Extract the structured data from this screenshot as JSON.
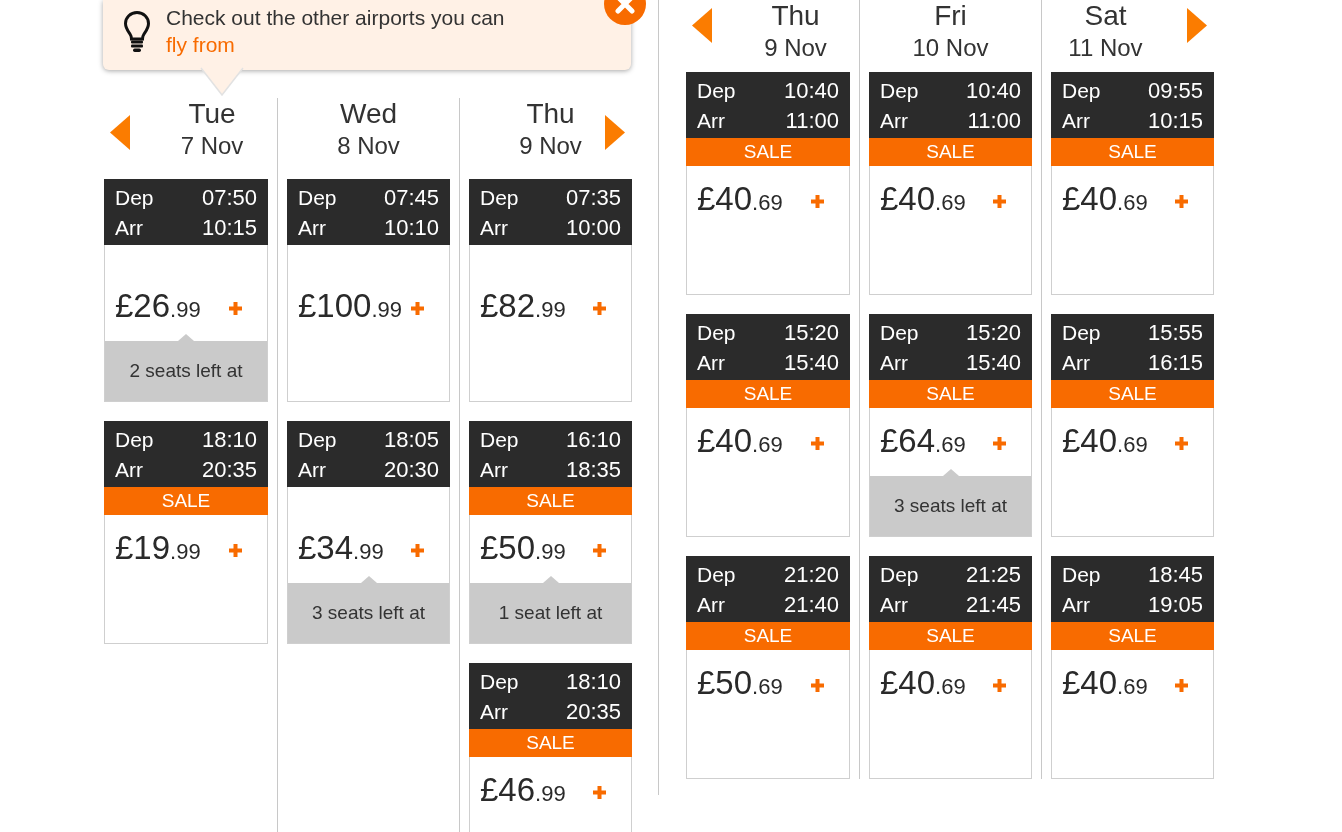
{
  "tip": {
    "text": "Check out the other airports you can",
    "link": "fly from"
  },
  "panels": [
    {
      "days": [
        {
          "name": "Tue",
          "date": "7 Nov",
          "flights": [
            {
              "dep_label": "Dep",
              "dep_time": "07:50",
              "arr_label": "Arr",
              "arr_time": "10:15",
              "price": "£26",
              "pence": ".99",
              "seats": "2 seats left at"
            },
            {
              "dep_label": "Dep",
              "dep_time": "18:10",
              "arr_label": "Arr",
              "arr_time": "20:35",
              "badge": "SALE",
              "price": "£19",
              "pence": ".99"
            }
          ]
        },
        {
          "name": "Wed",
          "date": "8 Nov",
          "flights": [
            {
              "dep_label": "Dep",
              "dep_time": "07:45",
              "arr_label": "Arr",
              "arr_time": "10:10",
              "price": "£100",
              "pence": ".99"
            },
            {
              "dep_label": "Dep",
              "dep_time": "18:05",
              "arr_label": "Arr",
              "arr_time": "20:30",
              "price": "£34",
              "pence": ".99",
              "seats": "3 seats left at"
            }
          ]
        },
        {
          "name": "Thu",
          "date": "9 Nov",
          "flights": [
            {
              "dep_label": "Dep",
              "dep_time": "07:35",
              "arr_label": "Arr",
              "arr_time": "10:00",
              "price": "£82",
              "pence": ".99"
            },
            {
              "dep_label": "Dep",
              "dep_time": "16:10",
              "arr_label": "Arr",
              "arr_time": "18:35",
              "badge": "SALE",
              "price": "£50",
              "pence": ".99",
              "seats": "1 seat left at"
            },
            {
              "dep_label": "Dep",
              "dep_time": "18:10",
              "arr_label": "Arr",
              "arr_time": "20:35",
              "badge": "SALE",
              "price": "£46",
              "pence": ".99"
            }
          ]
        }
      ]
    },
    {
      "days": [
        {
          "name": "Thu",
          "date": "9 Nov",
          "flights": [
            {
              "dep_label": "Dep",
              "dep_time": "10:40",
              "arr_label": "Arr",
              "arr_time": "11:00",
              "badge": "SALE",
              "price": "£40",
              "pence": ".69"
            },
            {
              "dep_label": "Dep",
              "dep_time": "15:20",
              "arr_label": "Arr",
              "arr_time": "15:40",
              "badge": "SALE",
              "price": "£40",
              "pence": ".69"
            },
            {
              "dep_label": "Dep",
              "dep_time": "21:20",
              "arr_label": "Arr",
              "arr_time": "21:40",
              "badge": "SALE",
              "price": "£50",
              "pence": ".69"
            }
          ]
        },
        {
          "name": "Fri",
          "date": "10 Nov",
          "flights": [
            {
              "dep_label": "Dep",
              "dep_time": "10:40",
              "arr_label": "Arr",
              "arr_time": "11:00",
              "badge": "SALE",
              "price": "£40",
              "pence": ".69"
            },
            {
              "dep_label": "Dep",
              "dep_time": "15:20",
              "arr_label": "Arr",
              "arr_time": "15:40",
              "badge": "SALE",
              "price": "£64",
              "pence": ".69",
              "seats": "3 seats left at"
            },
            {
              "dep_label": "Dep",
              "dep_time": "21:25",
              "arr_label": "Arr",
              "arr_time": "21:45",
              "badge": "SALE",
              "price": "£40",
              "pence": ".69"
            }
          ]
        },
        {
          "name": "Sat",
          "date": "11 Nov",
          "flights": [
            {
              "dep_label": "Dep",
              "dep_time": "09:55",
              "arr_label": "Arr",
              "arr_time": "10:15",
              "badge": "SALE",
              "price": "£40",
              "pence": ".69"
            },
            {
              "dep_label": "Dep",
              "dep_time": "15:55",
              "arr_label": "Arr",
              "arr_time": "16:15",
              "badge": "SALE",
              "price": "£40",
              "pence": ".69"
            },
            {
              "dep_label": "Dep",
              "dep_time": "18:45",
              "arr_label": "Arr",
              "arr_time": "19:05",
              "badge": "SALE",
              "price": "£40",
              "pence": ".69"
            }
          ]
        }
      ]
    }
  ]
}
